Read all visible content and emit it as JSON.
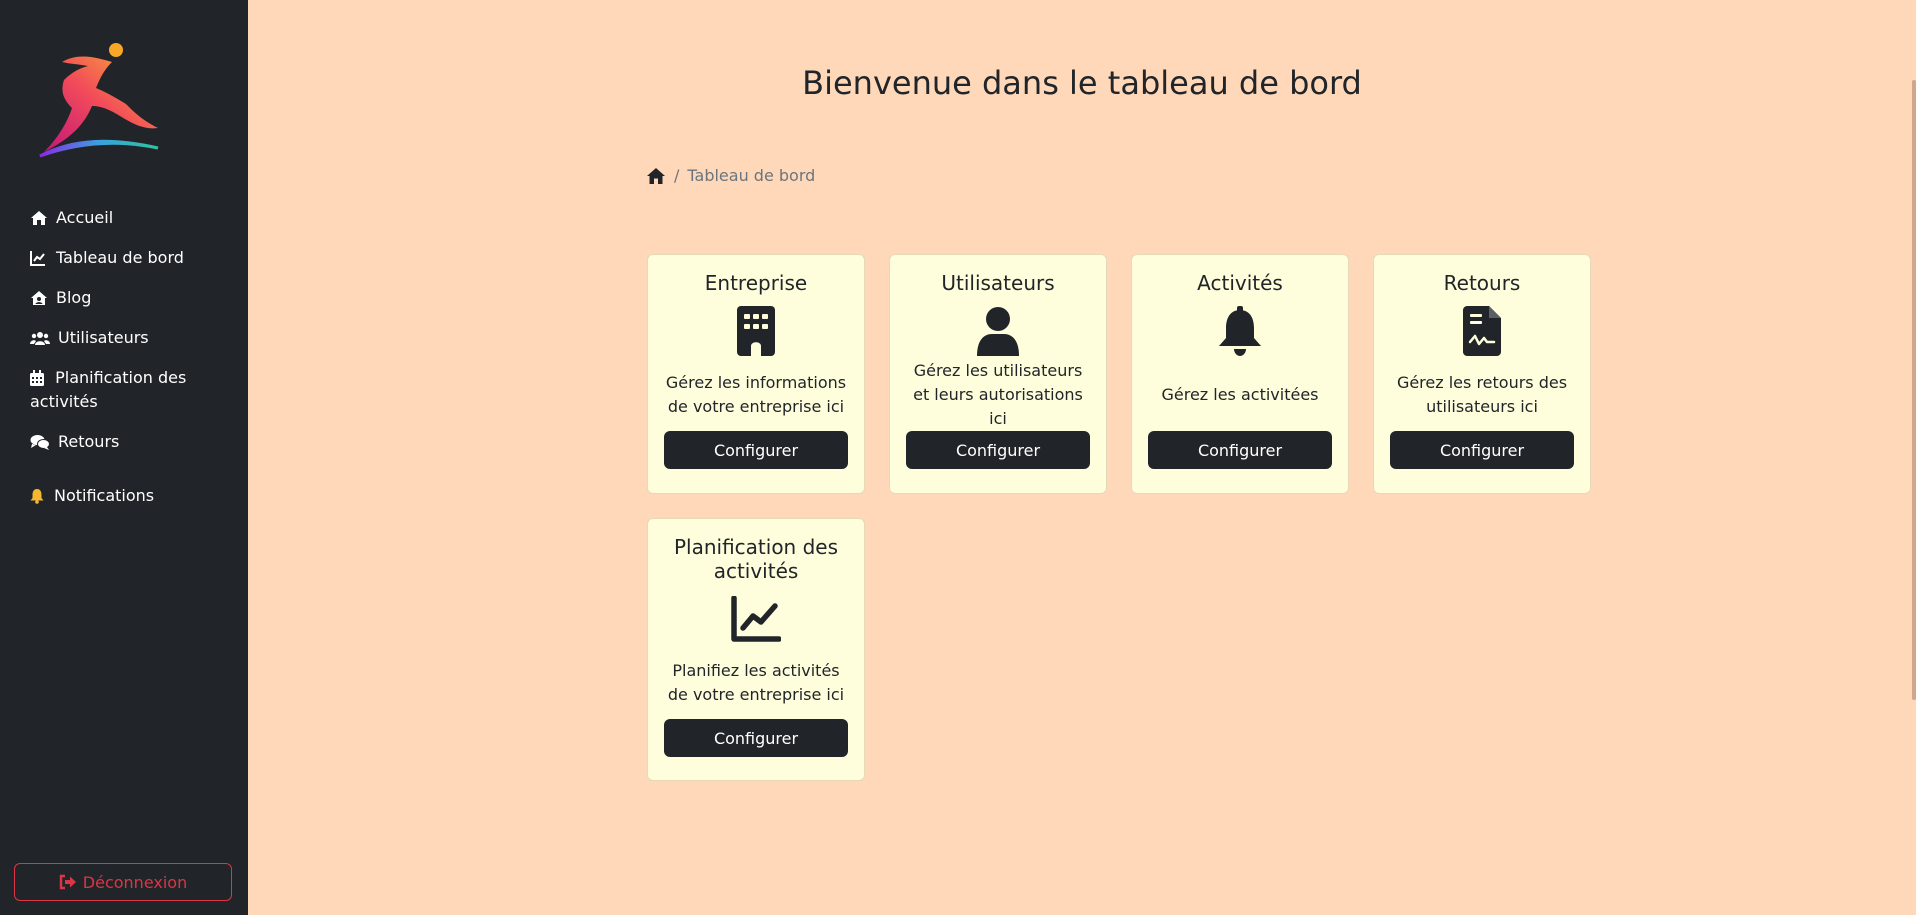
{
  "sidebar": {
    "items": [
      {
        "label": "Accueil",
        "icon": "home-icon"
      },
      {
        "label": "Tableau de bord",
        "icon": "chart-line-icon"
      },
      {
        "label": "Blog",
        "icon": "house-user-icon"
      },
      {
        "label": "Utilisateurs",
        "icon": "users-icon"
      },
      {
        "label": "Planification des activités",
        "icon": "calendar-icon"
      },
      {
        "label": "Retours",
        "icon": "comments-icon"
      },
      {
        "label": "Notifications",
        "icon": "bell-icon"
      }
    ],
    "logout_label": "Déconnexion"
  },
  "main": {
    "title": "Bienvenue dans le tableau de bord",
    "breadcrumb": {
      "separator": "/",
      "current": "Tableau de bord"
    },
    "cards": [
      {
        "title": "Entreprise",
        "description": "Gérez les informations de votre entreprise ici",
        "button": "Configurer",
        "icon": "building-icon"
      },
      {
        "title": "Utilisateurs",
        "description": "Gérez les utilisateurs et leurs autorisations ici",
        "button": "Configurer",
        "icon": "user-icon"
      },
      {
        "title": "Activités",
        "description": "Gérez les activitées",
        "button": "Configurer",
        "icon": "bell-icon"
      },
      {
        "title": "Retours",
        "description": "Gérez les retours des utilisateurs ici",
        "button": "Configurer",
        "icon": "file-signature-icon"
      },
      {
        "title": "Planification des activités",
        "description": "Planifiez les activités de votre entreprise ici",
        "button": "Configurer",
        "icon": "chart-line-icon"
      }
    ]
  },
  "colors": {
    "sidebar_bg": "#212529",
    "page_bg": "#fed8b8",
    "card_bg": "#fffedc",
    "logout": "#dc3545",
    "notification_bell": "#f5b82e"
  }
}
